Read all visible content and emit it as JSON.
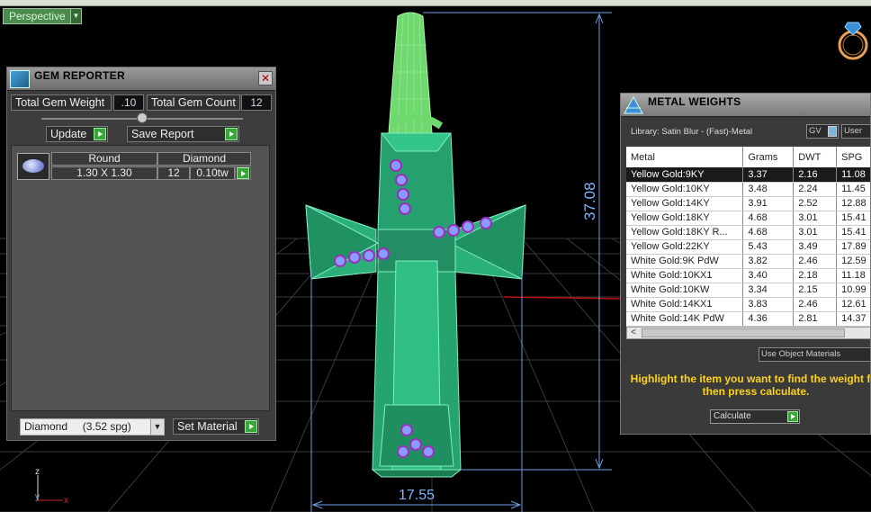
{
  "viewport": {
    "view_mode": "Perspective",
    "dimension_height": "37.08",
    "dimension_width": "17.55",
    "axis_labels": {
      "x": "x",
      "y": "y",
      "z": "z"
    },
    "colors": {
      "model": "#2fbf86",
      "bail": "#7fe07f",
      "dimension": "#6e9ee8",
      "gem": "#8a9cff",
      "prong": "#9b2fbf"
    }
  },
  "gem_reporter": {
    "title": "GEM REPORTER",
    "close_icon": "close-icon",
    "total_gem_weight_label": "Total Gem Weight",
    "total_gem_weight_value": ".10",
    "total_gem_count_label": "Total Gem Count",
    "total_gem_count_value": "12",
    "update_label": "Update",
    "save_report_label": "Save Report",
    "gem_row": {
      "shape": "Round",
      "size": "1.30 X 1.30",
      "material": "Diamond",
      "count": "12",
      "weight": "0.10tw"
    },
    "material_select": "Diamond     (3.52 spg)",
    "set_material_label": "Set Material"
  },
  "metal_weights": {
    "title": "METAL WEIGHTS",
    "library": "Library: Satin Blur - (Fast)-Metal",
    "gv_label": "GV",
    "user_label": "User",
    "columns": [
      "Metal",
      "Grams",
      "DWT",
      "SPG"
    ],
    "rows": [
      {
        "metal": "Yellow Gold:9KY",
        "grams": "3.37",
        "dwt": "2.16",
        "spg": "11.08",
        "selected": true
      },
      {
        "metal": "Yellow Gold:10KY",
        "grams": "3.48",
        "dwt": "2.24",
        "spg": "11.45",
        "selected": false
      },
      {
        "metal": "Yellow Gold:14KY",
        "grams": "3.91",
        "dwt": "2.52",
        "spg": "12.88",
        "selected": false
      },
      {
        "metal": "Yellow Gold:18KY",
        "grams": "4.68",
        "dwt": "3.01",
        "spg": "15.41",
        "selected": false
      },
      {
        "metal": "Yellow Gold:18KY R...",
        "grams": "4.68",
        "dwt": "3.01",
        "spg": "15.41",
        "selected": false
      },
      {
        "metal": "Yellow Gold:22KY",
        "grams": "5.43",
        "dwt": "3.49",
        "spg": "17.89",
        "selected": false
      },
      {
        "metal": "White Gold:9K PdW",
        "grams": "3.82",
        "dwt": "2.46",
        "spg": "12.59",
        "selected": false
      },
      {
        "metal": "White Gold:10KX1",
        "grams": "3.40",
        "dwt": "2.18",
        "spg": "11.18",
        "selected": false
      },
      {
        "metal": "White Gold:10KW",
        "grams": "3.34",
        "dwt": "2.15",
        "spg": "10.99",
        "selected": false
      },
      {
        "metal": "White Gold:14KX1",
        "grams": "3.83",
        "dwt": "2.46",
        "spg": "12.61",
        "selected": false
      },
      {
        "metal": "White Gold:14K PdW",
        "grams": "4.36",
        "dwt": "2.81",
        "spg": "14.37",
        "selected": false
      }
    ],
    "use_object_materials": "Use Object Materials",
    "hint": "Highlight the item you want to find the weight for then press calculate.",
    "calculate_label": "Calculate"
  }
}
